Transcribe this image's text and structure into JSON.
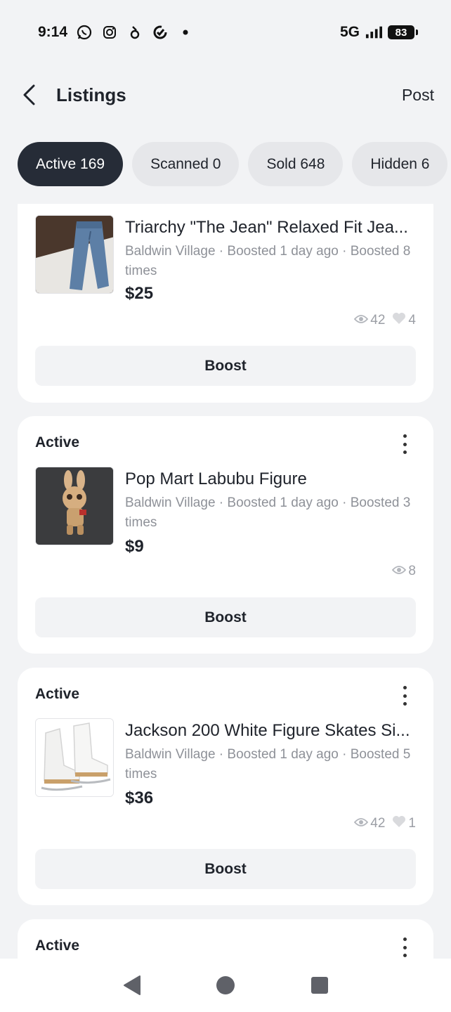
{
  "status_bar": {
    "time": "9:14",
    "network": "5G",
    "battery": "83",
    "icons": [
      "whatsapp-icon",
      "instagram-icon",
      "app-icon",
      "sync-icon",
      "dot-icon",
      "signal-icon",
      "battery-icon"
    ]
  },
  "header": {
    "title": "Listings",
    "post_label": "Post"
  },
  "tabs": [
    {
      "label": "Active 169",
      "active": true
    },
    {
      "label": "Scanned 0",
      "active": false
    },
    {
      "label": "Sold 648",
      "active": false
    },
    {
      "label": "Hidden 6",
      "active": false
    }
  ],
  "listings": [
    {
      "status": "",
      "title": "Triarchy \"The Jean\" Relaxed Fit Jea...",
      "meta": "Baldwin Village · Boosted 1 day ago · Boosted 8 times",
      "price": "$25",
      "views": "42",
      "likes": "4",
      "boost_label": "Boost"
    },
    {
      "status": "Active",
      "title": "Pop Mart Labubu Figure",
      "meta": "Baldwin Village · Boosted 1 day ago · Boosted 3 times",
      "price": "$9",
      "views": "8",
      "likes": "",
      "boost_label": "Boost"
    },
    {
      "status": "Active",
      "title": "Jackson 200 White Figure Skates Si...",
      "meta": "Baldwin Village · Boosted 1 day ago · Boosted 5 times",
      "price": "$36",
      "views": "42",
      "likes": "1",
      "boost_label": "Boost"
    },
    {
      "status": "Active"
    }
  ],
  "colors": {
    "background": "#f2f3f5",
    "active_tab": "#262c37",
    "inactive_tab": "#e6e7ea",
    "muted_text": "#8e9198"
  }
}
